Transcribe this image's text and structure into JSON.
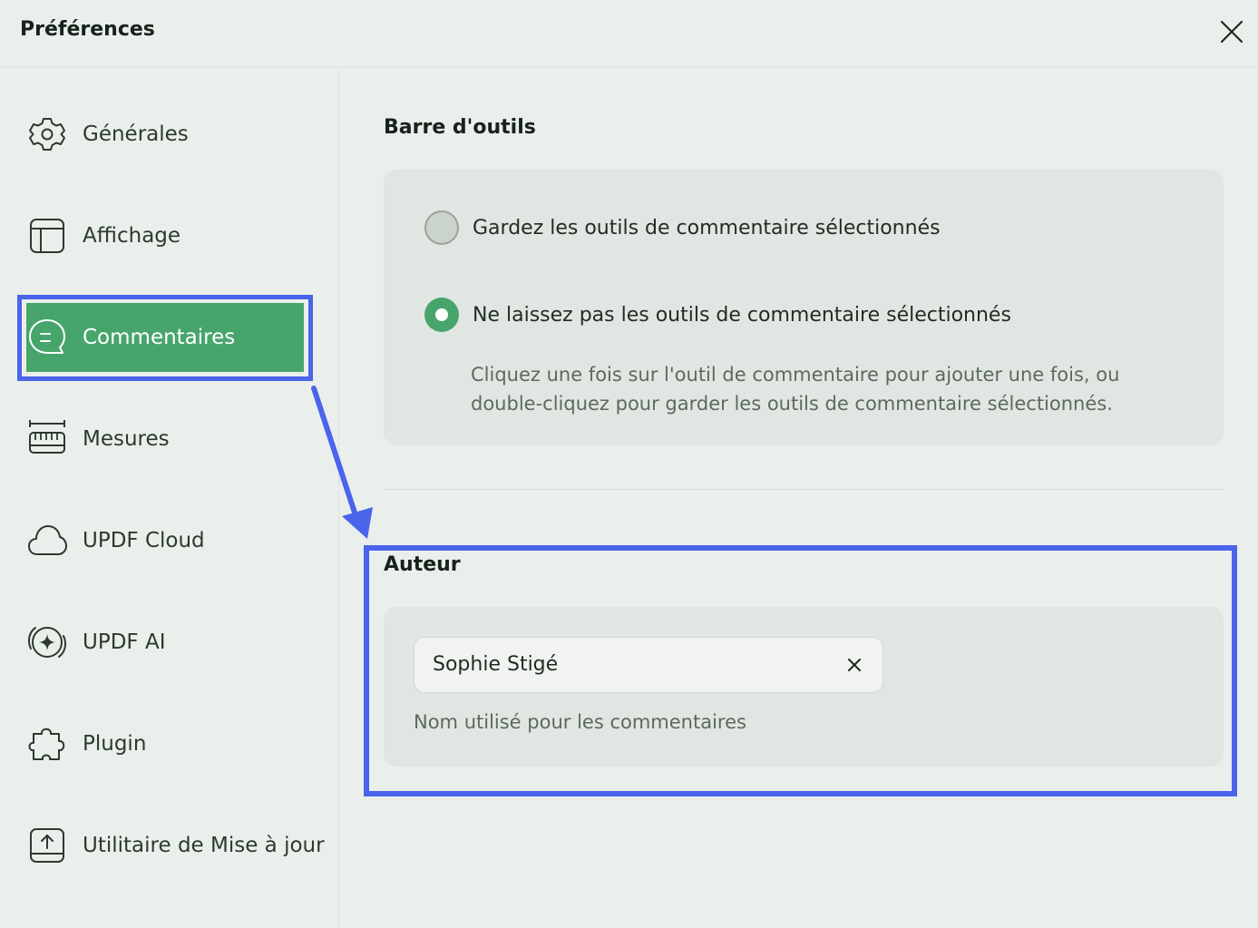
{
  "window": {
    "title": "Préférences"
  },
  "sidebar": {
    "items": [
      {
        "label": "Générales",
        "icon": "gear-icon"
      },
      {
        "label": "Affichage",
        "icon": "layout-icon"
      },
      {
        "label": "Commentaires",
        "icon": "comment-icon",
        "active": true
      },
      {
        "label": "Mesures",
        "icon": "ruler-icon"
      },
      {
        "label": "UPDF Cloud",
        "icon": "cloud-icon"
      },
      {
        "label": "UPDF AI",
        "icon": "ai-sparkle-icon"
      },
      {
        "label": "Plugin",
        "icon": "puzzle-icon"
      },
      {
        "label": "Utilitaire de Mise à jour",
        "icon": "update-icon"
      }
    ]
  },
  "toolbar_section": {
    "title": "Barre d'outils",
    "options": [
      {
        "label": "Gardez les outils de commentaire sélectionnés",
        "selected": false
      },
      {
        "label": "Ne laissez pas les outils de commentaire sélectionnés",
        "selected": true
      }
    ],
    "hint_line1": "Cliquez une fois sur l'outil de commentaire pour ajouter une fois, ou",
    "hint_line2": "double-cliquez pour garder les outils de commentaire sélectionnés."
  },
  "author_section": {
    "title": "Auteur",
    "name_value": "Sophie Stigé",
    "caption": "Nom utilisé pour les commentaires"
  },
  "colors": {
    "accent": "#47a56c",
    "highlight": "#4a64eb",
    "background": "#ebefeb",
    "card": "#e2e6e2"
  }
}
